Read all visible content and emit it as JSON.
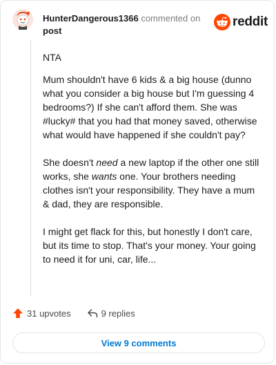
{
  "comment": {
    "username": "HunterDangerous1366",
    "action_text": " commented on",
    "post_link": "post",
    "brand_name": "reddit",
    "paragraphs": [
      {
        "segments": [
          {
            "text": "NTA"
          }
        ]
      },
      {
        "segments": [
          {
            "text": "Mum shouldn't have 6 kids & a big house (dunno what you consider a big house but I'm guessing 4 bedrooms?) If she can't afford them. She was #lucky# that you had that money saved, otherwise what would have happened if she couldn't pay?"
          }
        ]
      },
      {
        "segments": [
          {
            "text": "She doesn't "
          },
          {
            "text": "need",
            "italic": true
          },
          {
            "text": " a new laptop if the other one still works, she "
          },
          {
            "text": "wants",
            "italic": true
          },
          {
            "text": " one. Your brothers needing clothes isn't your responsibility. They have a mum & dad, they are responsible."
          }
        ]
      },
      {
        "segments": [
          {
            "text": "I might get flack for this, but honestly I don't care, but its time to stop. That's your money. Your going to need it for uni, car, life..."
          }
        ]
      }
    ],
    "upvotes_label": "31 upvotes",
    "replies_label": "9 replies",
    "view_comments_label": "View 9 comments"
  },
  "colors": {
    "brand_orange": "#ff4500",
    "upvote_orange": "#ff4500",
    "link_blue": "#0079d3",
    "muted_text": "#7c7c7c"
  },
  "icons": {
    "avatar": "snoo-avatar-icon",
    "brand": "reddit-logo-icon",
    "upvote": "upvote-arrow-icon",
    "reply": "reply-arrow-icon"
  }
}
